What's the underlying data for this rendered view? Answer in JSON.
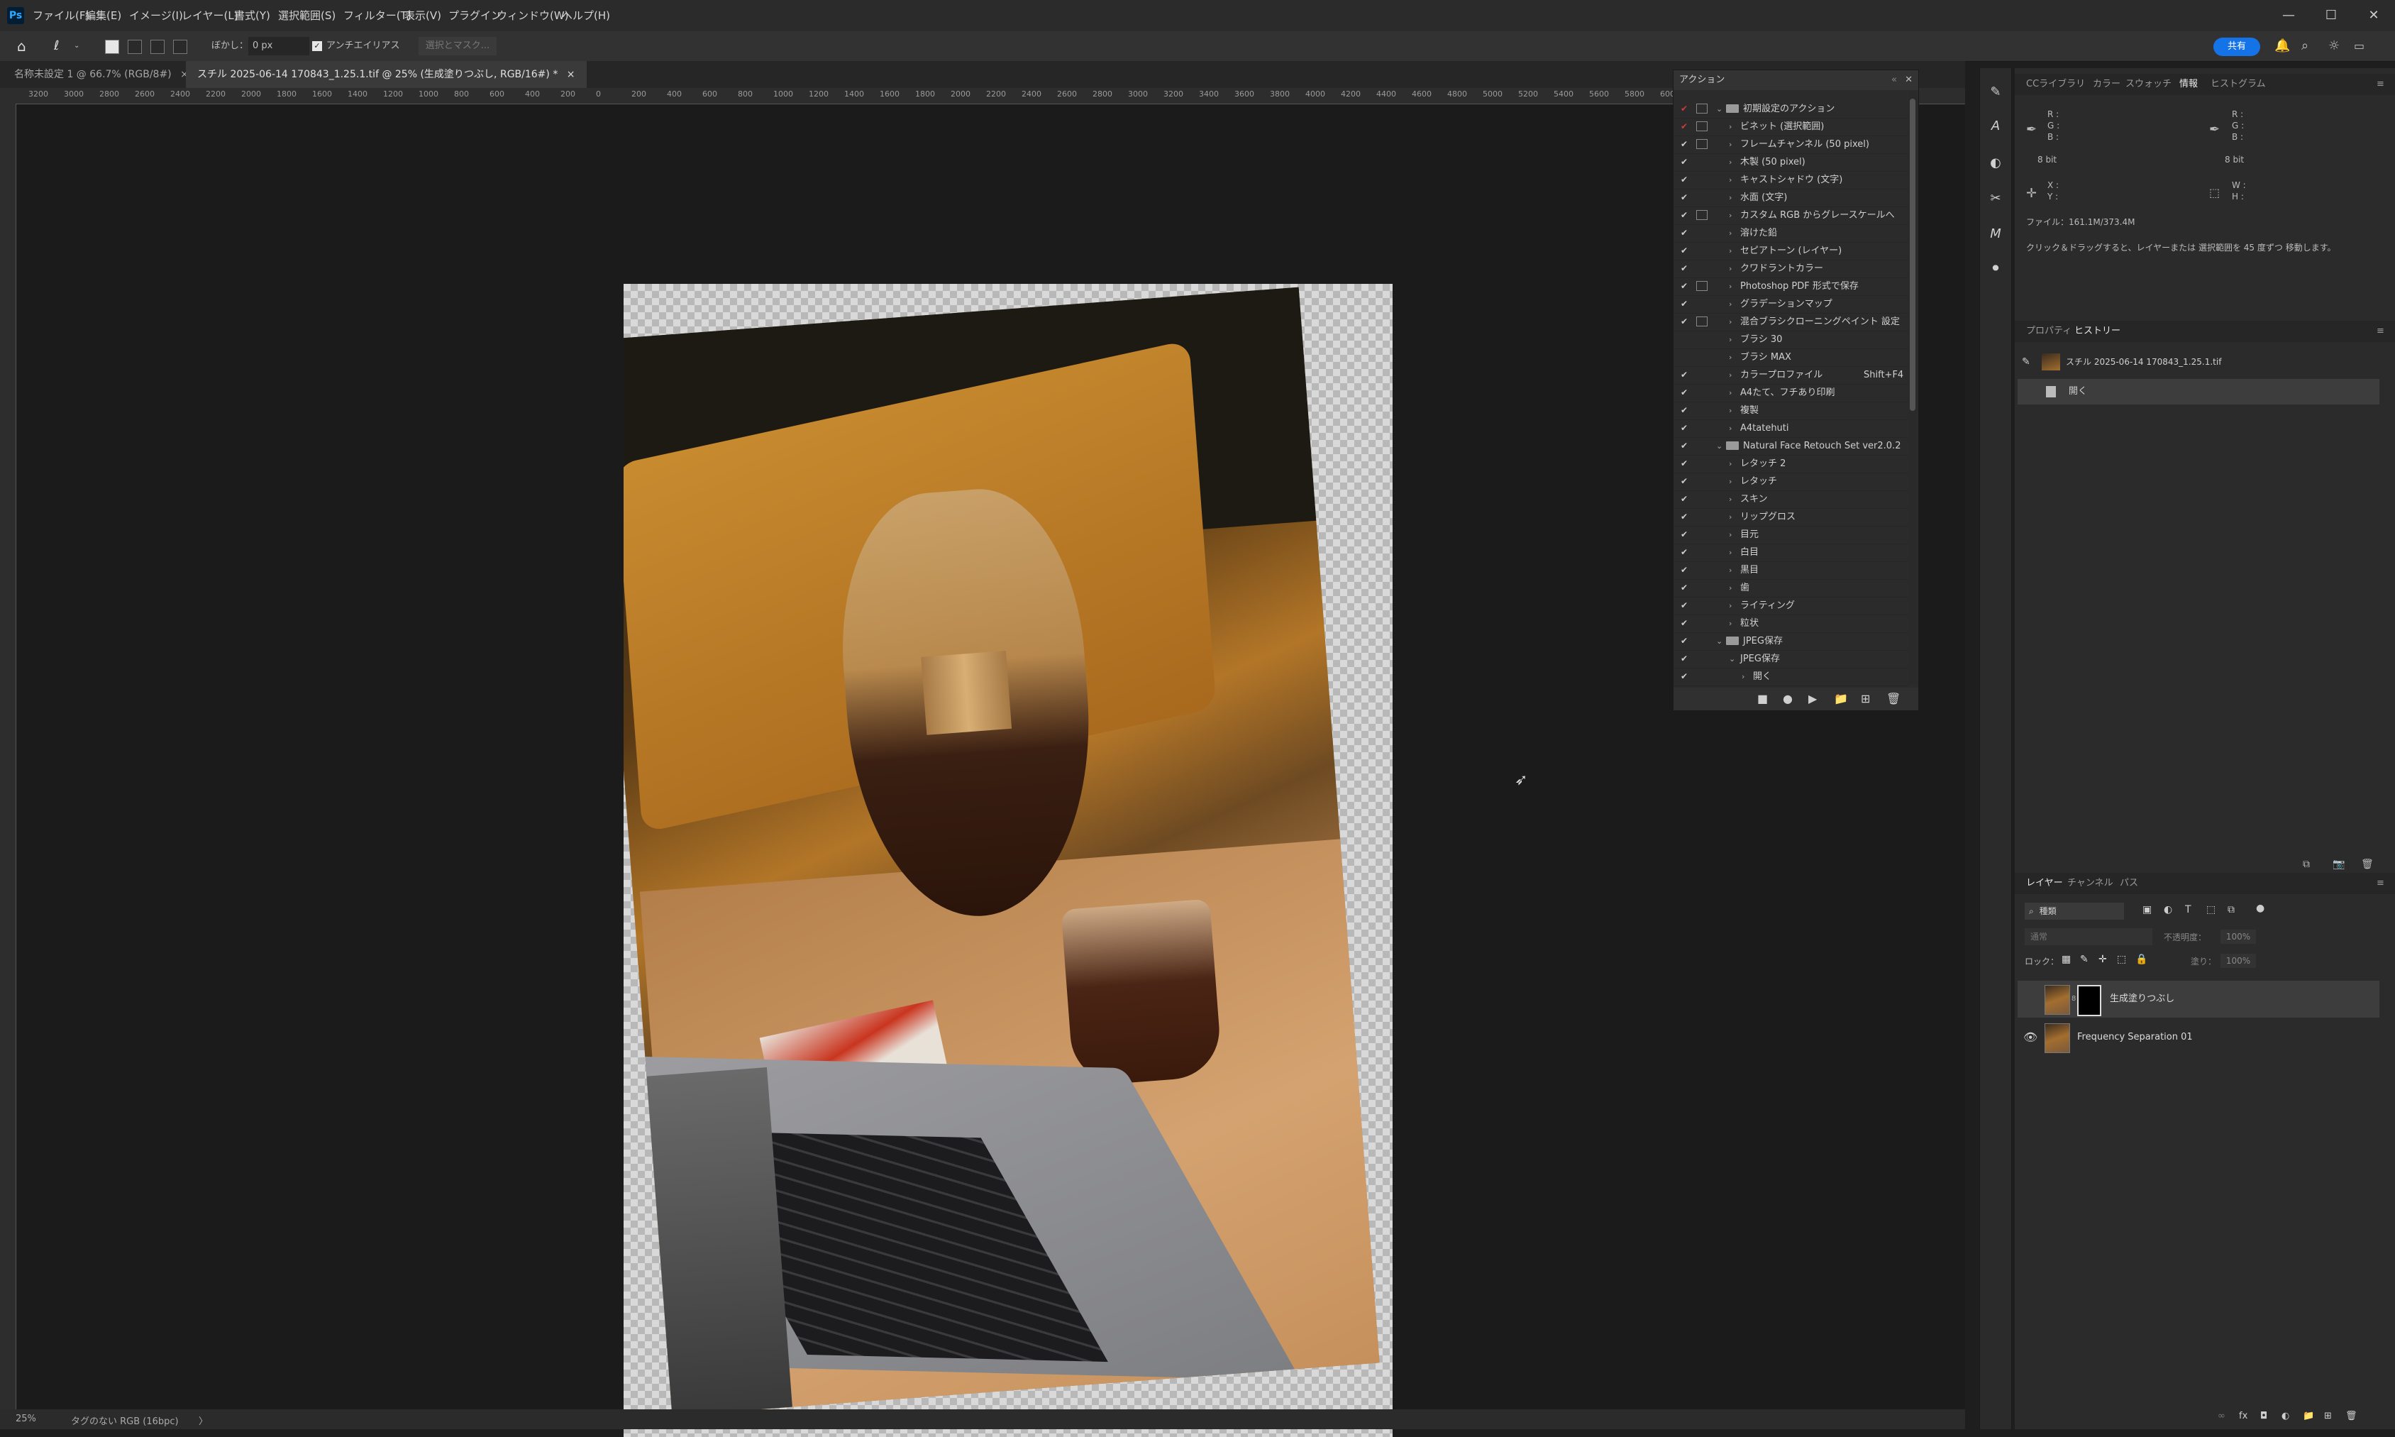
{
  "menubar": {
    "app_icon": "Ps",
    "items": [
      "ファイル(F)",
      "編集(E)",
      "イメージ(I)",
      "レイヤー(L)",
      "書式(Y)",
      "選択範囲(S)",
      "フィルター(T)",
      "表示(V)",
      "プラグイン",
      "ウィンドウ(W)",
      "ヘルプ(H)"
    ],
    "minimize": "—",
    "maximize": "☐",
    "close": "✕"
  },
  "options": {
    "feather_label": "ぼかし：",
    "feather_value": "0 px",
    "antialias_label": "アンチエイリアス",
    "select_mask": "選択とマスク...",
    "share": "共有"
  },
  "tabs": [
    {
      "label": "名称未設定 1 @ 66.7% (RGB/8#)",
      "close": "×"
    },
    {
      "label": "スチル 2025-06-14 170843_1.25.1.tif @ 25% (生成塗りつぶし, RGB/16#) *",
      "close": "×"
    }
  ],
  "ruler_ticks": [
    "3200",
    "3000",
    "2800",
    "2600",
    "2400",
    "2200",
    "2000",
    "1800",
    "1600",
    "1400",
    "1200",
    "1000",
    "800",
    "600",
    "400",
    "200",
    "0",
    "200",
    "400",
    "600",
    "800",
    "1000",
    "1200",
    "1400",
    "1600",
    "1800",
    "2000",
    "2200",
    "2400",
    "2600",
    "2800",
    "3000",
    "3200",
    "3400",
    "3600",
    "3800",
    "4000",
    "4200",
    "4400",
    "4600",
    "4800",
    "5000",
    "5200",
    "5400",
    "5600",
    "5800",
    "6000",
    "6200"
  ],
  "status": {
    "zoom": "25%",
    "profile": "タグのない RGB (16bpc)",
    "arrow": "〉"
  },
  "actions_panel": {
    "title": "アクション",
    "rows": [
      {
        "check": "✔",
        "red": true,
        "dialog": true,
        "level": 0,
        "type": "set",
        "expanded": true,
        "label": "初期設定のアクション",
        "shortcut": ""
      },
      {
        "check": "✔",
        "red": true,
        "dialog": true,
        "level": 1,
        "type": "action",
        "label": "ビネット (選択範囲)",
        "shortcut": ""
      },
      {
        "check": "✔",
        "red": false,
        "dialog": true,
        "level": 1,
        "type": "action",
        "label": "フレームチャンネル (50 pixel)",
        "shortcut": ""
      },
      {
        "check": "✔",
        "red": false,
        "dialog": false,
        "level": 1,
        "type": "action",
        "label": "木製 (50 pixel)",
        "shortcut": ""
      },
      {
        "check": "✔",
        "red": false,
        "dialog": false,
        "level": 1,
        "type": "action",
        "label": "キャストシャドウ (文字)",
        "shortcut": ""
      },
      {
        "check": "✔",
        "red": false,
        "dialog": false,
        "level": 1,
        "type": "action",
        "label": "水面 (文字)",
        "shortcut": ""
      },
      {
        "check": "✔",
        "red": false,
        "dialog": true,
        "level": 1,
        "type": "action",
        "label": "カスタム RGB からグレースケールへ",
        "shortcut": ""
      },
      {
        "check": "✔",
        "red": false,
        "dialog": false,
        "level": 1,
        "type": "action",
        "label": "溶けた鉛",
        "shortcut": ""
      },
      {
        "check": "✔",
        "red": false,
        "dialog": false,
        "level": 1,
        "type": "action",
        "label": "セピアトーン (レイヤー)",
        "shortcut": ""
      },
      {
        "check": "✔",
        "red": false,
        "dialog": false,
        "level": 1,
        "type": "action",
        "label": "クワドラントカラー",
        "shortcut": ""
      },
      {
        "check": "✔",
        "red": false,
        "dialog": true,
        "level": 1,
        "type": "action",
        "label": "Photoshop PDF 形式で保存",
        "shortcut": ""
      },
      {
        "check": "✔",
        "red": false,
        "dialog": false,
        "level": 1,
        "type": "action",
        "label": "グラデーションマップ",
        "shortcut": ""
      },
      {
        "check": "✔",
        "red": false,
        "dialog": true,
        "level": 1,
        "type": "action",
        "label": "混合ブラシクローニングペイント 設定",
        "shortcut": ""
      },
      {
        "check": "",
        "red": false,
        "dialog": false,
        "level": 1,
        "type": "action",
        "label": "ブラシ 30",
        "shortcut": ""
      },
      {
        "check": "",
        "red": false,
        "dialog": false,
        "level": 1,
        "type": "action",
        "label": "ブラシ MAX",
        "shortcut": ""
      },
      {
        "check": "✔",
        "red": false,
        "dialog": false,
        "level": 1,
        "type": "action",
        "label": "カラープロファイル",
        "shortcut": "Shift+F4"
      },
      {
        "check": "✔",
        "red": false,
        "dialog": false,
        "level": 1,
        "type": "action",
        "label": "A4たて、フチあり印刷",
        "shortcut": ""
      },
      {
        "check": "✔",
        "red": false,
        "dialog": false,
        "level": 1,
        "type": "action",
        "label": "複製",
        "shortcut": ""
      },
      {
        "check": "✔",
        "red": false,
        "dialog": false,
        "level": 1,
        "type": "action",
        "label": "A4tatehuti",
        "shortcut": ""
      },
      {
        "check": "✔",
        "red": false,
        "dialog": false,
        "level": 0,
        "type": "set",
        "expanded": true,
        "label": "Natural Face Retouch Set ver2.0.2",
        "shortcut": ""
      },
      {
        "check": "✔",
        "red": false,
        "dialog": false,
        "level": 1,
        "type": "action",
        "label": "レタッチ 2",
        "shortcut": ""
      },
      {
        "check": "✔",
        "red": false,
        "dialog": false,
        "level": 1,
        "type": "action",
        "label": "レタッチ",
        "shortcut": ""
      },
      {
        "check": "✔",
        "red": false,
        "dialog": false,
        "level": 1,
        "type": "action",
        "label": "スキン",
        "shortcut": ""
      },
      {
        "check": "✔",
        "red": false,
        "dialog": false,
        "level": 1,
        "type": "action",
        "label": "リップグロス",
        "shortcut": ""
      },
      {
        "check": "✔",
        "red": false,
        "dialog": false,
        "level": 1,
        "type": "action",
        "label": "目元",
        "shortcut": ""
      },
      {
        "check": "✔",
        "red": false,
        "dialog": false,
        "level": 1,
        "type": "action",
        "label": "白目",
        "shortcut": ""
      },
      {
        "check": "✔",
        "red": false,
        "dialog": false,
        "level": 1,
        "type": "action",
        "label": "黒目",
        "shortcut": ""
      },
      {
        "check": "✔",
        "red": false,
        "dialog": false,
        "level": 1,
        "type": "action",
        "label": "歯",
        "shortcut": ""
      },
      {
        "check": "✔",
        "red": false,
        "dialog": false,
        "level": 1,
        "type": "action",
        "label": "ライティング",
        "shortcut": ""
      },
      {
        "check": "✔",
        "red": false,
        "dialog": false,
        "level": 1,
        "type": "action",
        "label": "粒状",
        "shortcut": ""
      },
      {
        "check": "✔",
        "red": false,
        "dialog": false,
        "level": 0,
        "type": "set",
        "expanded": true,
        "label": "JPEG保存",
        "shortcut": ""
      },
      {
        "check": "✔",
        "red": false,
        "dialog": false,
        "level": 1,
        "type": "action",
        "expanded": true,
        "label": "JPEG保存",
        "shortcut": ""
      },
      {
        "check": "✔",
        "red": false,
        "dialog": false,
        "level": 2,
        "type": "step",
        "label": "開く",
        "shortcut": ""
      }
    ],
    "footer_icons": [
      "■",
      "●",
      "▶",
      "📁",
      "⊞",
      "🗑"
    ]
  },
  "info_panel": {
    "tabs": [
      "CCライブラリ",
      "カラー",
      "スウォッチ",
      "情報",
      "ヒストグラム"
    ],
    "active_tab": "情報",
    "rgb_left": [
      "R :",
      "G :",
      "B :"
    ],
    "rgb_right": [
      "R :",
      "G :",
      "B :"
    ],
    "bit_left": "8 bit",
    "bit_right": "8 bit",
    "xy": [
      "X :",
      "Y :"
    ],
    "wh": [
      "W :",
      "H :"
    ],
    "file": "ファイル：161.1M/373.4M",
    "hint": "クリック＆ドラッグすると、レイヤーまたは 選択範囲を 45 度ずつ 移動します。"
  },
  "history_panel": {
    "tabs": [
      "プロパティ",
      "ヒストリー"
    ],
    "active_tab": "ヒストリー",
    "snapshot": "スチル 2025-06-14 170843_1.25.1.tif",
    "items": [
      "開く"
    ]
  },
  "layers_panel": {
    "tabs": [
      "レイヤー",
      "チャンネル",
      "パス"
    ],
    "active_tab": "レイヤー",
    "filter": "種類",
    "blend": "通常",
    "opacity_label": "不透明度：",
    "opacity": "100%",
    "lock_label": "ロック：",
    "fill_label": "塗り：",
    "fill": "100%",
    "layers": [
      {
        "name": "生成塗りつぶし",
        "visible": false,
        "selected": true,
        "mask": true
      },
      {
        "name": "Frequency Separation 01",
        "visible": true,
        "selected": false,
        "mask": false
      }
    ],
    "footer_icons": [
      "∞",
      "fx",
      "◘",
      "◐",
      "📁",
      "⊞",
      "🗑"
    ]
  },
  "colors": {
    "accent": "#1473e6",
    "check_red": "#d03b3b",
    "panel_bg": "#2b2b2b",
    "canvas_bg": "#1b1b1b"
  }
}
